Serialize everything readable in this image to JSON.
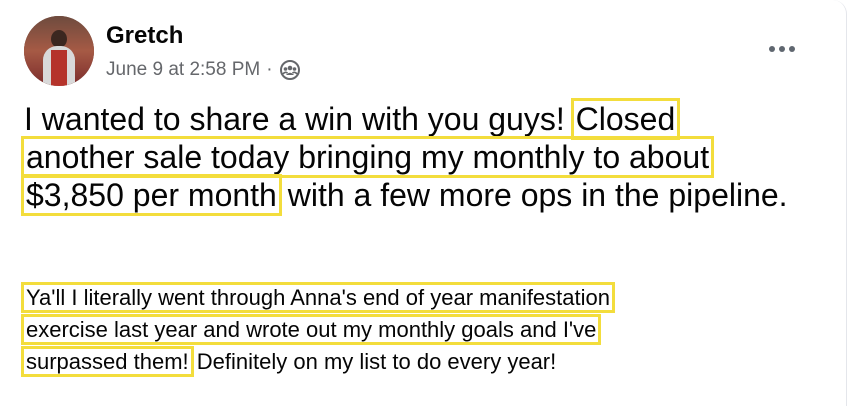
{
  "author": {
    "name": "Gretch"
  },
  "post_meta": {
    "timestamp": "June 9 at 2:58 PM",
    "separator": "·",
    "audience_icon": "group-icon"
  },
  "menu": {
    "icon": "more-options-icon"
  },
  "post": {
    "main_plain_1": "I wanted to share a win with you guys!",
    "main_hl_1": "Closed",
    "main_hl_2": "another sale today bringing my monthly to about",
    "main_hl_3": "$3,850 per month",
    "main_plain_2": "with a few more ops in the pipeline.",
    "sub_hl_1": "Ya'll I literally went through Anna's end of year manifestation",
    "sub_hl_2": "exercise last year and wrote out my monthly goals and I've",
    "sub_hl_3": "surpassed them!",
    "sub_plain_1": "Definitely on my list to do every year!"
  },
  "colors": {
    "highlight": "#f3dd3c",
    "meta_text": "#65676b"
  }
}
